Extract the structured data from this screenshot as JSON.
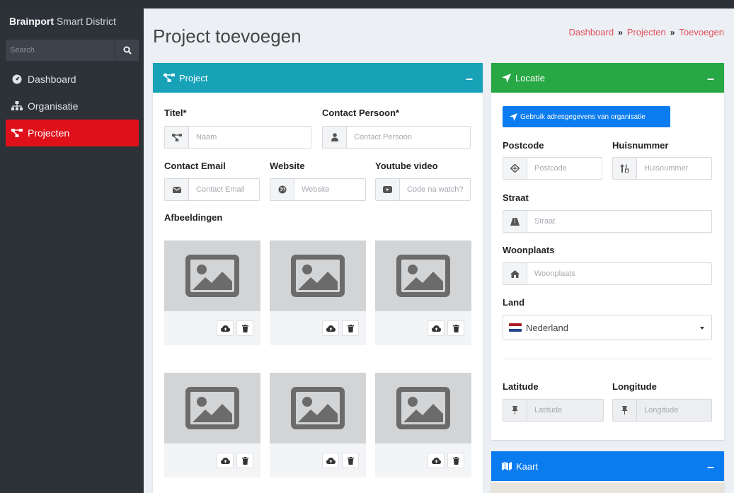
{
  "sidebar": {
    "brand_bold": "Brainport",
    "brand_rest": " Smart District",
    "search_placeholder": "Search",
    "items": [
      {
        "label": "Dashboard",
        "icon": "dashboard-icon",
        "active": false
      },
      {
        "label": "Organisatie",
        "icon": "sitemap-icon",
        "active": false
      },
      {
        "label": "Projecten",
        "icon": "project-diagram-icon",
        "active": true
      }
    ]
  },
  "page": {
    "title": "Project toevoegen",
    "breadcrumb": [
      "Dashboard",
      "Projecten",
      "Toevoegen"
    ],
    "breadcrumb_sep": "»"
  },
  "project": {
    "header": "Project",
    "minimize": "–",
    "titel_label": "Titel*",
    "titel_placeholder": "Naam",
    "contact_person_label": "Contact Persoon*",
    "contact_person_placeholder": "Contact Persoon",
    "contact_email_label": "Contact Email",
    "contact_email_placeholder": "Contact Email",
    "website_label": "Website",
    "website_placeholder": "Website",
    "youtube_label": "Youtube video",
    "youtube_placeholder": "Code na watch?",
    "images_label": "Afbeeldingen",
    "image_count": 6
  },
  "locatie": {
    "header": "Locatie",
    "minimize": "–",
    "use_org_button": "Gebruik adresgegevens van organisatie",
    "postcode_label": "Postcode",
    "postcode_placeholder": "Postcode",
    "huisnummer_label": "Huisnummer",
    "huisnummer_placeholder": "Huisnummer",
    "straat_label": "Straat",
    "straat_placeholder": "Straat",
    "woonplaats_label": "Woonplaats",
    "woonplaats_placeholder": "Woonplaats",
    "land_label": "Land",
    "land_value": "Nederland",
    "latitude_label": "Latitude",
    "latitude_placeholder": "Latitude",
    "longitude_label": "Longitude",
    "longitude_placeholder": "Longitude"
  },
  "kaart": {
    "header": "Kaart",
    "minimize": "–"
  },
  "colors": {
    "sidebar_bg": "#2d3238",
    "active_nav": "#e0101a",
    "project_header": "#17a2b8",
    "locatie_header": "#28a745",
    "kaart_header": "#0a7cf0",
    "breadcrumb": "#e0525a"
  }
}
